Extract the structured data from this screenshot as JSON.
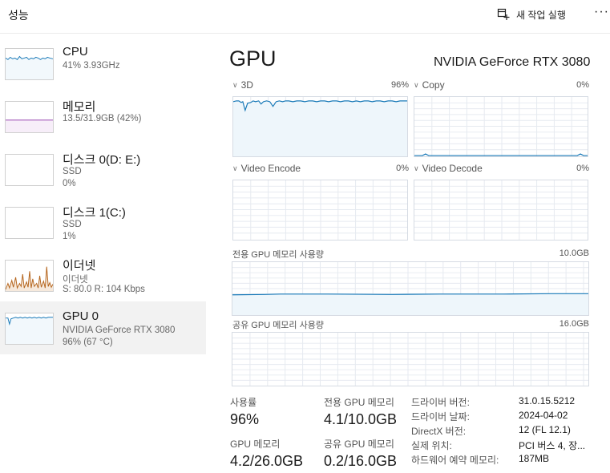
{
  "header": {
    "title": "성능",
    "new_task_label": "새 작업 실행",
    "more_label": "···"
  },
  "sidebar": {
    "items": [
      {
        "name": "CPU",
        "sub1": "41% 3.93GHz",
        "sub2": "",
        "sub3": ""
      },
      {
        "name": "메모리",
        "sub1": "13.5/31.9GB (42%)",
        "sub2": "",
        "sub3": ""
      },
      {
        "name": "디스크 0(D: E:)",
        "sub1": "SSD",
        "sub2": "0%",
        "sub3": ""
      },
      {
        "name": "디스크 1(C:)",
        "sub1": "SSD",
        "sub2": "1%",
        "sub3": ""
      },
      {
        "name": "이더넷",
        "sub1": "이더넷",
        "sub2": "S: 80.0  R: 104 Kbps",
        "sub3": ""
      },
      {
        "name": "GPU 0",
        "sub1": "NVIDIA GeForce RTX 3080",
        "sub2": "96% (67 °C)",
        "sub3": ""
      }
    ]
  },
  "main": {
    "title": "GPU",
    "device": "NVIDIA GeForce RTX 3080",
    "engines": [
      {
        "label": "3D",
        "value": "96%"
      },
      {
        "label": "Copy",
        "value": "0%"
      },
      {
        "label": "Video Encode",
        "value": "0%"
      },
      {
        "label": "Video Decode",
        "value": "0%"
      }
    ],
    "dedicated_graph": {
      "label": "전용 GPU 메모리 사용량",
      "max": "10.0GB"
    },
    "shared_graph": {
      "label": "공유 GPU 메모리 사용량",
      "max": "16.0GB"
    },
    "stats": {
      "utilization_label": "사용률",
      "utilization": "96%",
      "dedicated_label": "전용 GPU 메모리",
      "dedicated": "4.1/10.0GB",
      "gpu_memory_label": "GPU 메모리",
      "gpu_memory": "4.2/26.0GB",
      "shared_label": "공유 GPU 메모리",
      "shared": "0.2/16.0GB"
    },
    "properties": [
      {
        "label": "드라이버 버전:",
        "value": "31.0.15.5212"
      },
      {
        "label": "드라이버 날짜:",
        "value": "2024-04-02"
      },
      {
        "label": "DirectX 버전:",
        "value": "12 (FL 12.1)"
      },
      {
        "label": "실제 위치:",
        "value": "PCI 버스 4, 장..."
      },
      {
        "label": "하드웨어 예약 메모리:",
        "value": "187MB"
      }
    ]
  },
  "colors": {
    "gpu_line": "#1a7ab8",
    "gpu_fill": "#f2f8fc",
    "memory_line": "#8b2fa8",
    "ethernet_line": "#b5651d",
    "grid": "#e6eaf0"
  },
  "icons": {
    "new_task": "new-task-icon",
    "chevron": "chevron-down-icon"
  }
}
